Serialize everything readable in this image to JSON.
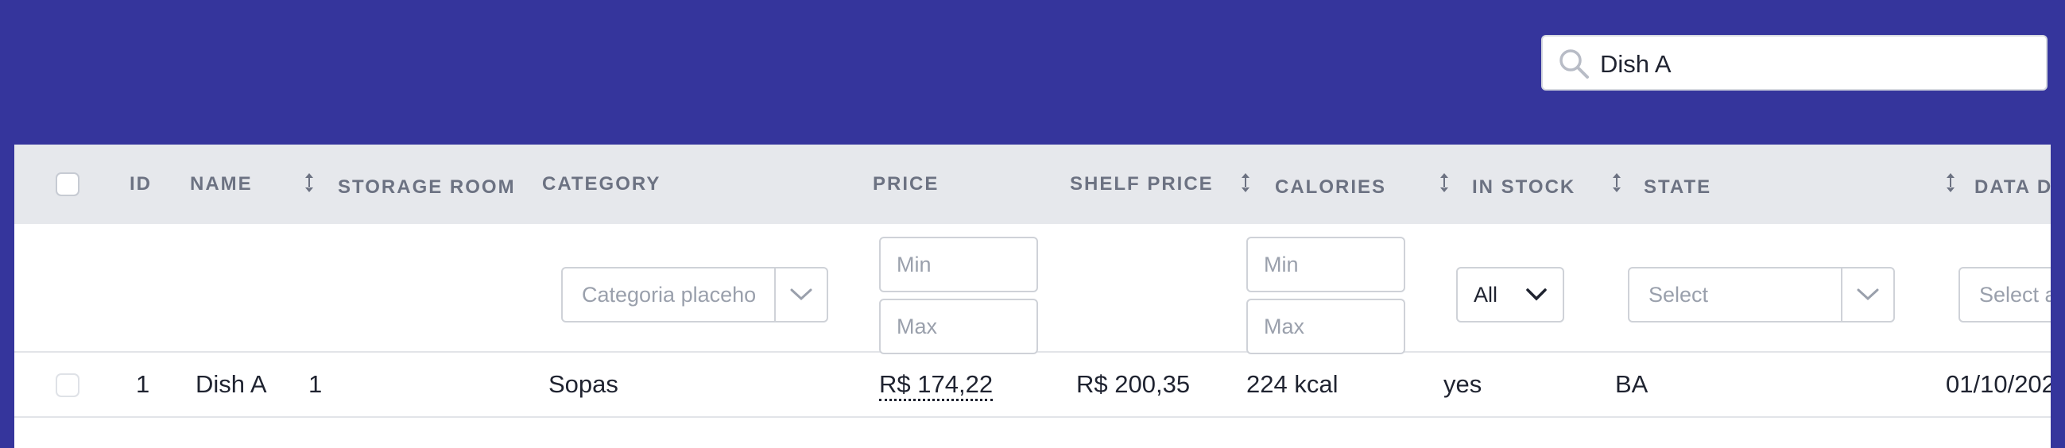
{
  "search": {
    "value": "Dish A",
    "placeholder": ""
  },
  "columns": {
    "id": "ID",
    "name": "NAME",
    "storage_room": "STORAGE ROOM",
    "category": "CATEGORY",
    "price": "PRICE",
    "shelf_price": "SHELF PRICE",
    "calories": "CALORIES",
    "in_stock": "IN STOCK",
    "state": "STATE",
    "data": "DATA D"
  },
  "filters": {
    "category_placeholder": "Categoria placeho",
    "price_min": "Min",
    "price_max": "Max",
    "calories_min": "Min",
    "calories_max": "Max",
    "in_stock_value": "All",
    "state_placeholder": "Select",
    "data_placeholder": "Select a"
  },
  "rows": [
    {
      "id": "1",
      "name": "Dish A",
      "storage_room": "1",
      "category": "Sopas",
      "price": "R$ 174,22",
      "shelf_price": "R$ 200,35",
      "calories": "224 kcal",
      "in_stock": "yes",
      "state": "BA",
      "data": "01/10/202"
    }
  ],
  "colors": {
    "background": "#35359c",
    "header": "#e6e8ec",
    "text": "#1f2330",
    "muted": "#6c7282"
  }
}
